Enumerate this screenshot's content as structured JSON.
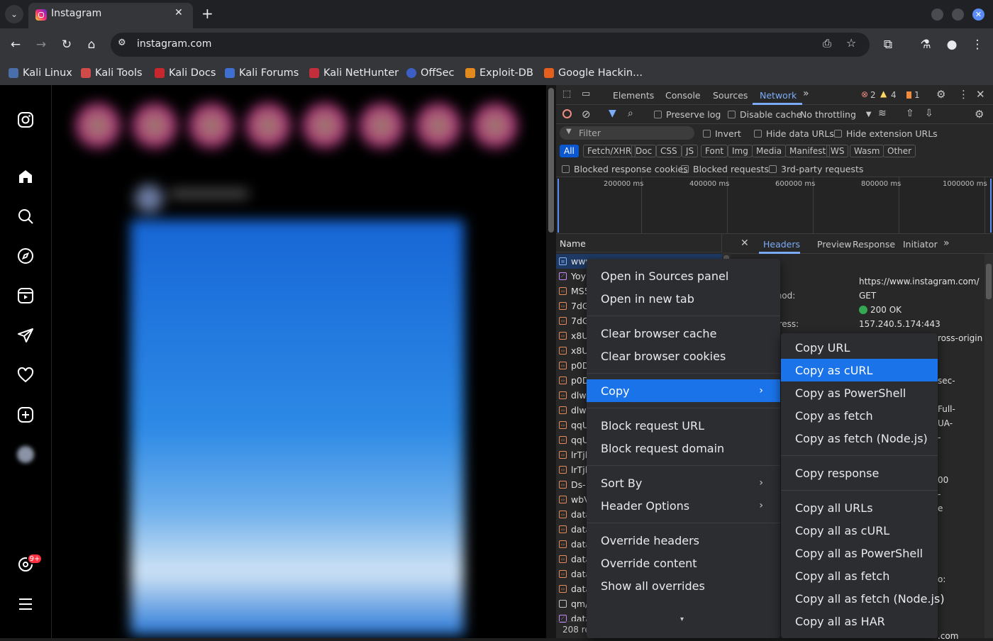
{
  "browser": {
    "tab_title": "Instagram",
    "tab_close": "✕",
    "new_tab": "+",
    "url": "instagram.com",
    "bookmarks": [
      "Kali Linux",
      "Kali Tools",
      "Kali Docs",
      "Kali Forums",
      "Kali NetHunter",
      "OffSec",
      "Exploit-DB",
      "Google Hackin..."
    ]
  },
  "instagram": {
    "notification_badge": "9+",
    "story_count": 8
  },
  "devtools": {
    "tabs": [
      "Elements",
      "Console",
      "Sources",
      "Network"
    ],
    "active_tab": "Network",
    "errors": "2",
    "warnings": "4",
    "issues": "1",
    "preserve_log": "Preserve log",
    "disable_cache": "Disable cache",
    "throttling": "No throttling",
    "filter_placeholder": "Filter",
    "invert": "Invert",
    "hide_data_urls": "Hide data URLs",
    "hide_extension_urls": "Hide extension URLs",
    "type_filters": [
      "All",
      "Fetch/XHR",
      "Doc",
      "CSS",
      "JS",
      "Font",
      "Img",
      "Media",
      "Manifest",
      "WS",
      "Wasm",
      "Other"
    ],
    "blocked_response_cookies": "Blocked response cookies",
    "blocked_requests": "Blocked requests",
    "third_party": "3rd-party requests",
    "timeline_labels": [
      "200000 ms",
      "400000 ms",
      "600000 ms",
      "800000 ms",
      "1000000 ms"
    ],
    "name_header": "Name",
    "requests": [
      "www",
      "Yoy",
      "MS5",
      "7dG",
      "7dG",
      "x8U",
      "x8U",
      "p0D",
      "p0D",
      "dlw",
      "dlw",
      "qqU",
      "qqU",
      "lrTjl",
      "lrTjl",
      "Ds-",
      "wbV",
      "data",
      "data",
      "data",
      "data",
      "data",
      "data",
      "qm/",
      "data"
    ],
    "request_count": "208 re",
    "detail_tabs": [
      "Headers",
      "Preview",
      "Response",
      "Initiator"
    ],
    "active_detail_tab": "Headers",
    "headers": [
      {
        "key": "L:",
        "value": "https://www.instagram.com/"
      },
      {
        "key": "thod:",
        "value": "GET"
      },
      {
        "key": ":",
        "value": "200 OK"
      },
      {
        "key": "dress:",
        "value": "157.240.5.174:443"
      }
    ],
    "header_fragments": [
      "ross-origin",
      "sec-",
      "Full-",
      "UA-",
      "-",
      "00",
      "-",
      "e",
      "o:",
      ".com"
    ]
  },
  "context_menu": {
    "items": [
      {
        "label": "Open in Sources panel"
      },
      {
        "label": "Open in new tab"
      },
      {
        "label": "Clear browser cache"
      },
      {
        "label": "Clear browser cookies"
      },
      {
        "label": "Copy",
        "submenu": true
      },
      {
        "label": "Block request URL"
      },
      {
        "label": "Block request domain"
      },
      {
        "label": "Sort By",
        "submenu": true
      },
      {
        "label": "Header Options",
        "submenu": true
      },
      {
        "label": "Override headers"
      },
      {
        "label": "Override content"
      },
      {
        "label": "Show all overrides"
      }
    ],
    "highlighted": "Copy"
  },
  "copy_submenu": {
    "items": [
      "Copy URL",
      "Copy as cURL",
      "Copy as PowerShell",
      "Copy as fetch",
      "Copy as fetch (Node.js)",
      "Copy response",
      "Copy all URLs",
      "Copy all as cURL",
      "Copy all as PowerShell",
      "Copy all as fetch",
      "Copy all as fetch (Node.js)",
      "Copy all as HAR"
    ],
    "highlighted": "Copy as cURL"
  },
  "colors": {
    "accent": "#1a73e8",
    "network_tab": "#7cacf8",
    "badge": "#ff3040"
  }
}
